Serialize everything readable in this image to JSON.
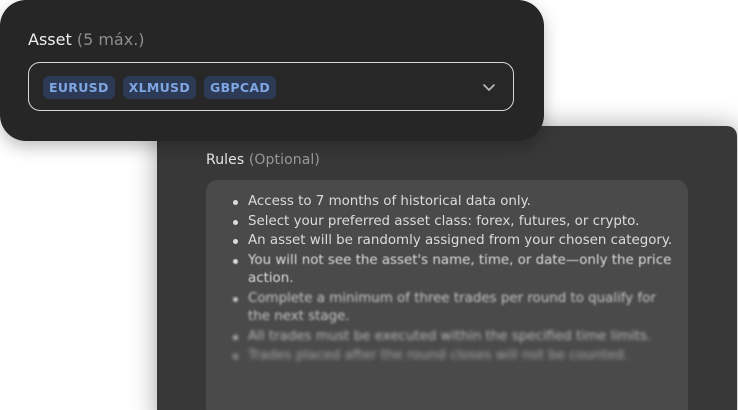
{
  "asset": {
    "label": "Asset",
    "limit_note": "(5 máx.)",
    "selected": [
      "EURUSD",
      "XLMUSD",
      "GBPCAD"
    ],
    "chip_bg": "#2c3a55",
    "chip_text": "#7fa6e3",
    "dropdown_icon": "chevron-down-icon"
  },
  "rules": {
    "title": "Rules",
    "optional_note": "(Optional)",
    "items": [
      "Access to 7 months of historical data only.",
      "Select your preferred asset class: forex, futures, or crypto.",
      "An asset will be randomly assigned from your chosen category.",
      "You will not see the asset's name, time, or date—only the price action.",
      "Complete a minimum of three trades per round to qualify for the next stage.",
      "All trades must be executed within the specified time limits.",
      "Trades placed after the round closes will not be counted."
    ]
  }
}
